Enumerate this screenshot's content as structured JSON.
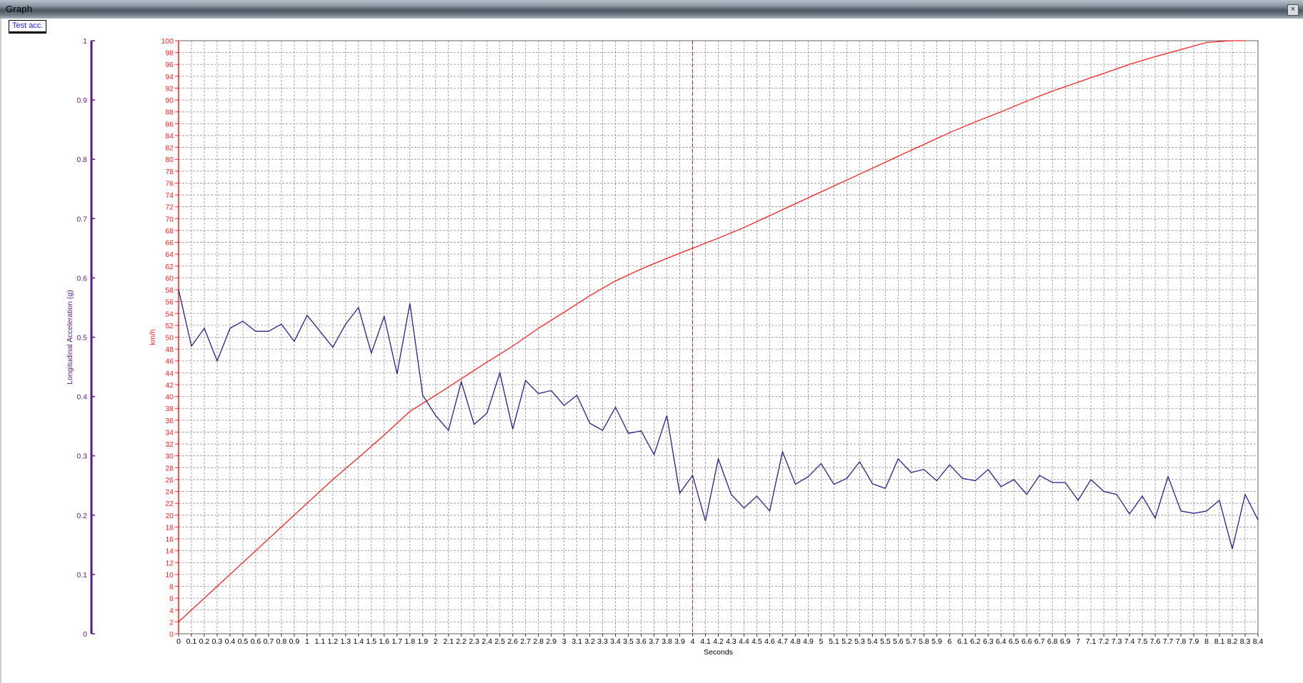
{
  "window": {
    "title": "Graph",
    "close_label": "×"
  },
  "tab": {
    "label": "Test acc."
  },
  "colors": {
    "speed": "#ff2020",
    "accel": "#2a1f8f",
    "accel_axis": "#5a1a8a",
    "grid": "#909090",
    "cursor": "#d02020"
  },
  "chart_data": {
    "type": "line",
    "xlabel": "Seconds",
    "ylabel_left": "Longitudinal Acceleration (g)",
    "ylabel_right": "km/h",
    "xlim": [
      0,
      8.4
    ],
    "ylim_speed": [
      0,
      100
    ],
    "ylim_accel": [
      0,
      1
    ],
    "grid": true,
    "cursor_x": 4.0,
    "x_tick_labels": [
      "0",
      "0.1",
      "0.2",
      "0.3",
      "0.4",
      "0.5",
      "0.6",
      "0.7",
      "0.8",
      "0.9",
      "1",
      "1.1",
      "1.2",
      "1.3",
      "1.4",
      "1.5",
      "1.6",
      "1.7",
      "1.8",
      "1.9",
      "2",
      "2.1",
      "2.2",
      "2.3",
      "2.4",
      "2.5",
      "2.6",
      "2.7",
      "2.8",
      "2.9",
      "3",
      "3.1",
      "3.2",
      "3.3",
      "3.4",
      "3.5",
      "3.6",
      "3.7",
      "3.8",
      "3.9",
      "4",
      "4.1",
      "4.2",
      "4.3",
      "4.4",
      "4.5",
      "4.6",
      "4.7",
      "4.8",
      "4.9",
      "5",
      "5.1",
      "5.2",
      "5.3",
      "5.4",
      "5.5",
      "5.6",
      "5.7",
      "5.8",
      "5.9",
      "6",
      "6.1",
      "6.2",
      "6.3",
      "6.4",
      "6.5",
      "6.6",
      "6.7",
      "6.8",
      "6.9",
      "7",
      "7.1",
      "7.2",
      "7.3",
      "7.4",
      "7.5",
      "7.6",
      "7.7",
      "7.8",
      "7.9",
      "8",
      "8.1",
      "8.2",
      "8.3",
      "8.4"
    ],
    "speed_tick_labels": [
      "0",
      "2",
      "4",
      "6",
      "8",
      "10",
      "12",
      "14",
      "16",
      "18",
      "20",
      "22",
      "24",
      "26",
      "28",
      "30",
      "32",
      "34",
      "36",
      "38",
      "40",
      "42",
      "44",
      "46",
      "48",
      "50",
      "52",
      "54",
      "56",
      "58",
      "60",
      "62",
      "64",
      "66",
      "68",
      "70",
      "72",
      "74",
      "76",
      "78",
      "80",
      "82",
      "84",
      "86",
      "88",
      "90",
      "92",
      "94",
      "96",
      "98",
      "100"
    ],
    "accel_tick_labels": [
      "0",
      "0.1",
      "0.2",
      "0.3",
      "0.4",
      "0.5",
      "0.6",
      "0.7",
      "0.8",
      "0.9",
      "1"
    ],
    "series": [
      {
        "name": "km/h",
        "x": [
          0,
          0.2,
          0.4,
          0.6,
          0.8,
          1.0,
          1.2,
          1.4,
          1.6,
          1.8,
          2.0,
          2.2,
          2.4,
          2.6,
          2.8,
          3.0,
          3.2,
          3.4,
          3.6,
          3.8,
          4.0,
          4.2,
          4.4,
          4.6,
          4.8,
          5.0,
          5.2,
          5.4,
          5.6,
          5.8,
          6.0,
          6.2,
          6.4,
          6.6,
          6.8,
          7.0,
          7.2,
          7.4,
          7.6,
          7.8,
          8.0,
          8.2,
          8.3
        ],
        "values": [
          2,
          6,
          10,
          14,
          18,
          22,
          26,
          29.7,
          33.5,
          37.5,
          40.2,
          43,
          45.8,
          48.5,
          51.5,
          54.2,
          57,
          59.5,
          61.5,
          63.3,
          65,
          66.7,
          68.5,
          70.5,
          72.5,
          74.5,
          76.5,
          78.5,
          80.5,
          82.5,
          84.5,
          86.3,
          88,
          89.8,
          91.5,
          93,
          94.5,
          96,
          97.3,
          98.5,
          99.7,
          100,
          100
        ]
      },
      {
        "name": "Longitudinal Acceleration (g)",
        "x": [
          0,
          0.1,
          0.2,
          0.3,
          0.4,
          0.5,
          0.6,
          0.7,
          0.8,
          0.9,
          1.0,
          1.1,
          1.2,
          1.3,
          1.4,
          1.5,
          1.6,
          1.7,
          1.8,
          1.9,
          2.0,
          2.1,
          2.2,
          2.3,
          2.4,
          2.5,
          2.6,
          2.7,
          2.8,
          2.9,
          3.0,
          3.1,
          3.2,
          3.3,
          3.4,
          3.5,
          3.6,
          3.7,
          3.8,
          3.9,
          4.0,
          4.1,
          4.2,
          4.3,
          4.4,
          4.5,
          4.6,
          4.7,
          4.8,
          4.9,
          5.0,
          5.1,
          5.2,
          5.3,
          5.4,
          5.5,
          5.6,
          5.7,
          5.8,
          5.9,
          6.0,
          6.1,
          6.2,
          6.3,
          6.4,
          6.5,
          6.6,
          6.7,
          6.8,
          6.9,
          7.0,
          7.1,
          7.2,
          7.3,
          7.4,
          7.5,
          7.6,
          7.7,
          7.8,
          7.9,
          8.0,
          8.1,
          8.2,
          8.3,
          8.4
        ],
        "values": [
          0.58,
          0.485,
          0.515,
          0.46,
          0.515,
          0.527,
          0.51,
          0.51,
          0.522,
          0.493,
          0.537,
          0.51,
          0.483,
          0.522,
          0.55,
          0.473,
          0.535,
          0.438,
          0.557,
          0.402,
          0.368,
          0.343,
          0.425,
          0.353,
          0.372,
          0.44,
          0.345,
          0.427,
          0.405,
          0.41,
          0.385,
          0.402,
          0.355,
          0.343,
          0.382,
          0.338,
          0.342,
          0.302,
          0.368,
          0.237,
          0.267,
          0.19,
          0.295,
          0.235,
          0.212,
          0.232,
          0.207,
          0.307,
          0.252,
          0.265,
          0.287,
          0.252,
          0.262,
          0.29,
          0.253,
          0.245,
          0.295,
          0.272,
          0.277,
          0.258,
          0.285,
          0.262,
          0.258,
          0.277,
          0.248,
          0.26,
          0.235,
          0.267,
          0.255,
          0.255,
          0.225,
          0.26,
          0.24,
          0.235,
          0.202,
          0.232,
          0.195,
          0.265,
          0.207,
          0.203,
          0.207,
          0.225,
          0.143,
          0.235,
          0.192
        ]
      }
    ]
  }
}
